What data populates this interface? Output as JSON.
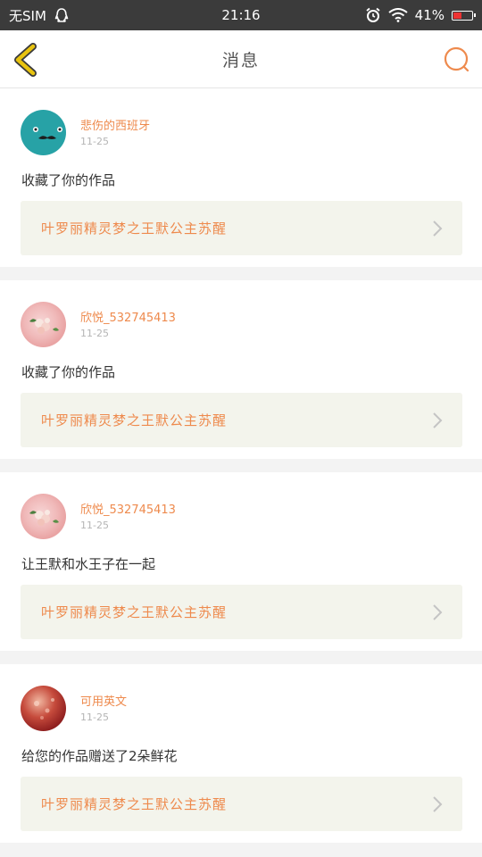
{
  "status_bar": {
    "carrier": "无SIM",
    "time": "21:16",
    "battery": "41%"
  },
  "header": {
    "title": "消息"
  },
  "colors": {
    "accent": "#ee8a4d",
    "back_icon": "#e8c30f",
    "card_link_bg": "#f3f4ec"
  },
  "notifications": [
    {
      "user": "悲伤的西班牙",
      "date": "11-25",
      "message": "收藏了你的作品",
      "work": "叶罗丽精灵梦之王默公主苏醒",
      "avatar": "mustache-face-avatar"
    },
    {
      "user": "欣悦_532745413",
      "date": "11-25",
      "message": "收藏了你的作品",
      "work": "叶罗丽精灵梦之王默公主苏醒",
      "avatar": "flower-avatar"
    },
    {
      "user": "欣悦_532745413",
      "date": "11-25",
      "message": "让王默和水王子在一起",
      "work": "叶罗丽精灵梦之王默公主苏醒",
      "avatar": "flower-avatar"
    },
    {
      "user": "可用英文",
      "date": "11-25",
      "message": "给您的作品赠送了2朵鲜花",
      "work": "叶罗丽精灵梦之王默公主苏醒",
      "avatar": "red-bokeh-avatar"
    }
  ]
}
